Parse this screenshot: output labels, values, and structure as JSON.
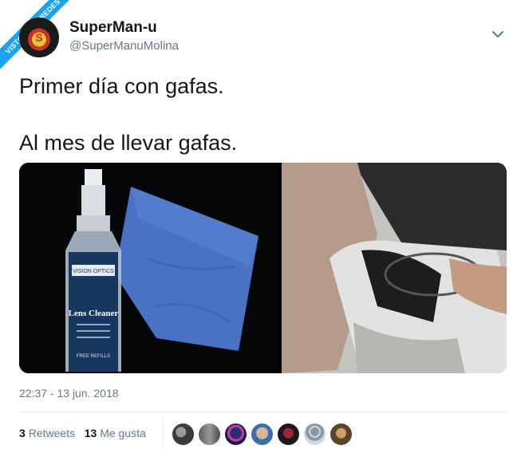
{
  "watermark": "VISTOENLASREDES",
  "user": {
    "name": "SuperMan-u",
    "handle": "@SuperManuMolina"
  },
  "tweet": {
    "line1": "Primer día con gafas.",
    "line2": "Al mes de llevar gafas.",
    "timestamp": "22:37 - 13 jun. 2018"
  },
  "stats": {
    "retweets_count": "3",
    "retweets_label": "Retweets",
    "likes_count": "13",
    "likes_label": "Me gusta"
  },
  "media": {
    "bottle_label": "Lens Cleaner",
    "bottle_brand": "VISION OPTICS",
    "bottle_subtext": "FREE REFILLS"
  },
  "colors": {
    "accent": "#1da1f2",
    "muted": "#657786",
    "text": "#14171a"
  }
}
